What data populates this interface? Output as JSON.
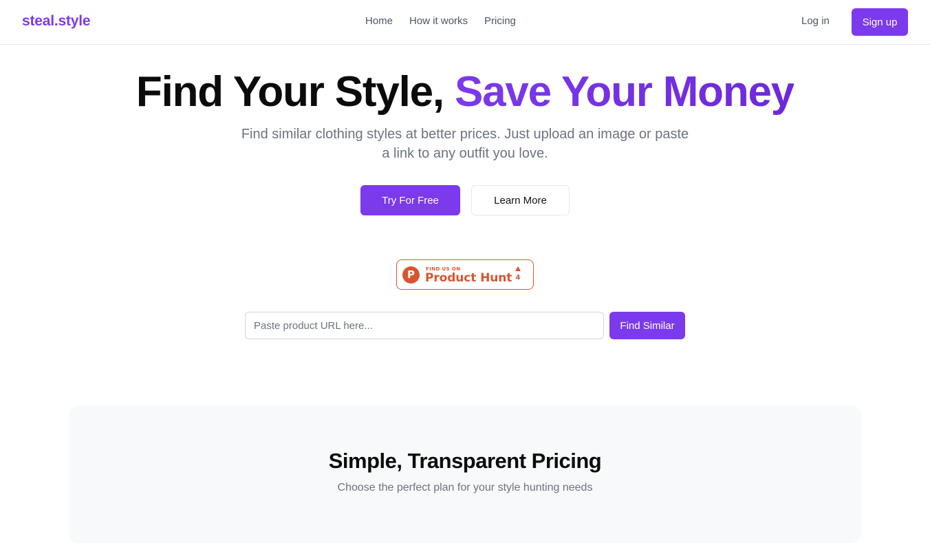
{
  "brand": {
    "name": "steal.style",
    "color": "#7c3aed"
  },
  "nav": {
    "links": [
      "Home",
      "How it works",
      "Pricing"
    ],
    "login_label": "Log in",
    "signup_label": "Sign up"
  },
  "hero": {
    "title_plain": "Find Your Style, ",
    "title_accent": "Save Your Money",
    "subtitle": "Find similar clothing styles at better prices. Just upload an image or paste a link to any outfit you love.",
    "primary_cta": "Try For Free",
    "secondary_cta": "Learn More"
  },
  "product_hunt": {
    "small_text": "FIND US ON",
    "big_text": "Product Hunt",
    "logo_letter": "P",
    "upvote_icon": "triangle-up-icon",
    "count": "4",
    "color": "#da552f"
  },
  "search": {
    "placeholder": "Paste product URL here...",
    "value": "",
    "button_label": "Find Similar"
  },
  "pricing": {
    "title": "Simple, Transparent Pricing",
    "subtitle": "Choose the perfect plan for your style hunting needs"
  }
}
